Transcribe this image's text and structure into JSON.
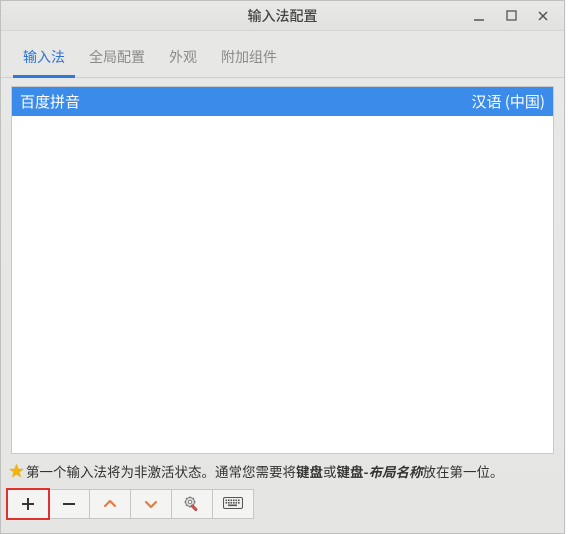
{
  "window": {
    "title": "输入法配置"
  },
  "tabs": [
    {
      "label": "输入法",
      "active": true
    },
    {
      "label": "全局配置",
      "active": false
    },
    {
      "label": "外观",
      "active": false
    },
    {
      "label": "附加组件",
      "active": false
    }
  ],
  "list": {
    "selected": {
      "name": "百度拼音",
      "lang": "汉语 (中国)"
    }
  },
  "hint": {
    "pre": "第一个输入法将为非激活状态。通常您需要将",
    "b1": "键盘",
    "mid": "或",
    "b2": "键盘",
    "dash": " - ",
    "i1": "布局名称",
    "post": "放在第一位。"
  },
  "toolbar": {
    "add": "add-icon",
    "remove": "remove-icon",
    "up": "up-icon",
    "down": "down-icon",
    "config": "config-icon",
    "keyboard": "keyboard-icon"
  }
}
